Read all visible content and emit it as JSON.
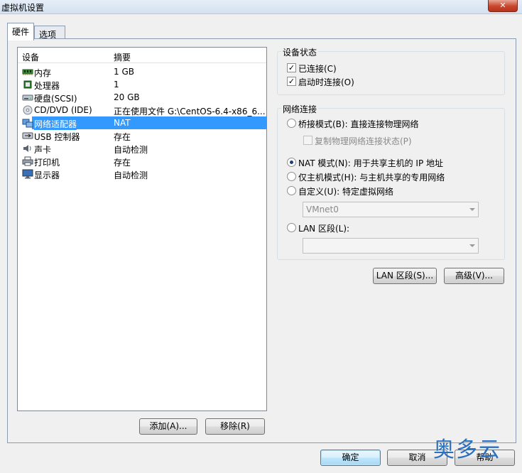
{
  "window": {
    "title": "虚拟机设置",
    "close_glyph": "✕"
  },
  "tabs": [
    {
      "label": "硬件"
    },
    {
      "label": "选项"
    }
  ],
  "device_list": {
    "col_device": "设备",
    "col_summary": "摘要",
    "rows": [
      {
        "name": "内存",
        "summary": "1 GB",
        "icon": "memory-icon"
      },
      {
        "name": "处理器",
        "summary": "1",
        "icon": "cpu-icon"
      },
      {
        "name": "硬盘(SCSI)",
        "summary": "20 GB",
        "icon": "harddisk-icon"
      },
      {
        "name": "CD/DVD (IDE)",
        "summary": "正在使用文件 G:\\CentOS-6.4-x86_6...",
        "icon": "cdrom-icon"
      },
      {
        "name": "网络适配器",
        "summary": "NAT",
        "icon": "network-adapter-icon"
      },
      {
        "name": "USB 控制器",
        "summary": "存在",
        "icon": "usb-icon"
      },
      {
        "name": "声卡",
        "summary": "自动检测",
        "icon": "sound-icon"
      },
      {
        "name": "打印机",
        "summary": "存在",
        "icon": "printer-icon"
      },
      {
        "name": "显示器",
        "summary": "自动检测",
        "icon": "display-icon"
      }
    ],
    "selected_index": 4
  },
  "buttons": {
    "add": "添加(A)...",
    "remove": "移除(R)",
    "lan_segment": "LAN 区段(S)...",
    "advanced": "高级(V)...",
    "ok": "确定",
    "cancel": "取消",
    "help": "帮助"
  },
  "device_status": {
    "title": "设备状态",
    "connected": {
      "label": "已连接(C)",
      "checked": true
    },
    "connect_on_power": {
      "label": "启动时连接(O)",
      "checked": true
    }
  },
  "network": {
    "title": "网络连接",
    "bridged": {
      "label": "桥接模式(B): 直接连接物理网络",
      "checked": false
    },
    "replicate": {
      "label": "复制物理网络连接状态(P)",
      "checked": false
    },
    "nat": {
      "label": "NAT 模式(N): 用于共享主机的 IP 地址",
      "checked": true
    },
    "host_only": {
      "label": "仅主机模式(H): 与主机共享的专用网络",
      "checked": false
    },
    "custom": {
      "label": "自定义(U): 特定虚拟网络",
      "checked": false
    },
    "custom_select": "VMnet0",
    "lan": {
      "label": "LAN 区段(L):",
      "checked": false
    },
    "lan_select": ""
  },
  "watermark": "奥多云"
}
